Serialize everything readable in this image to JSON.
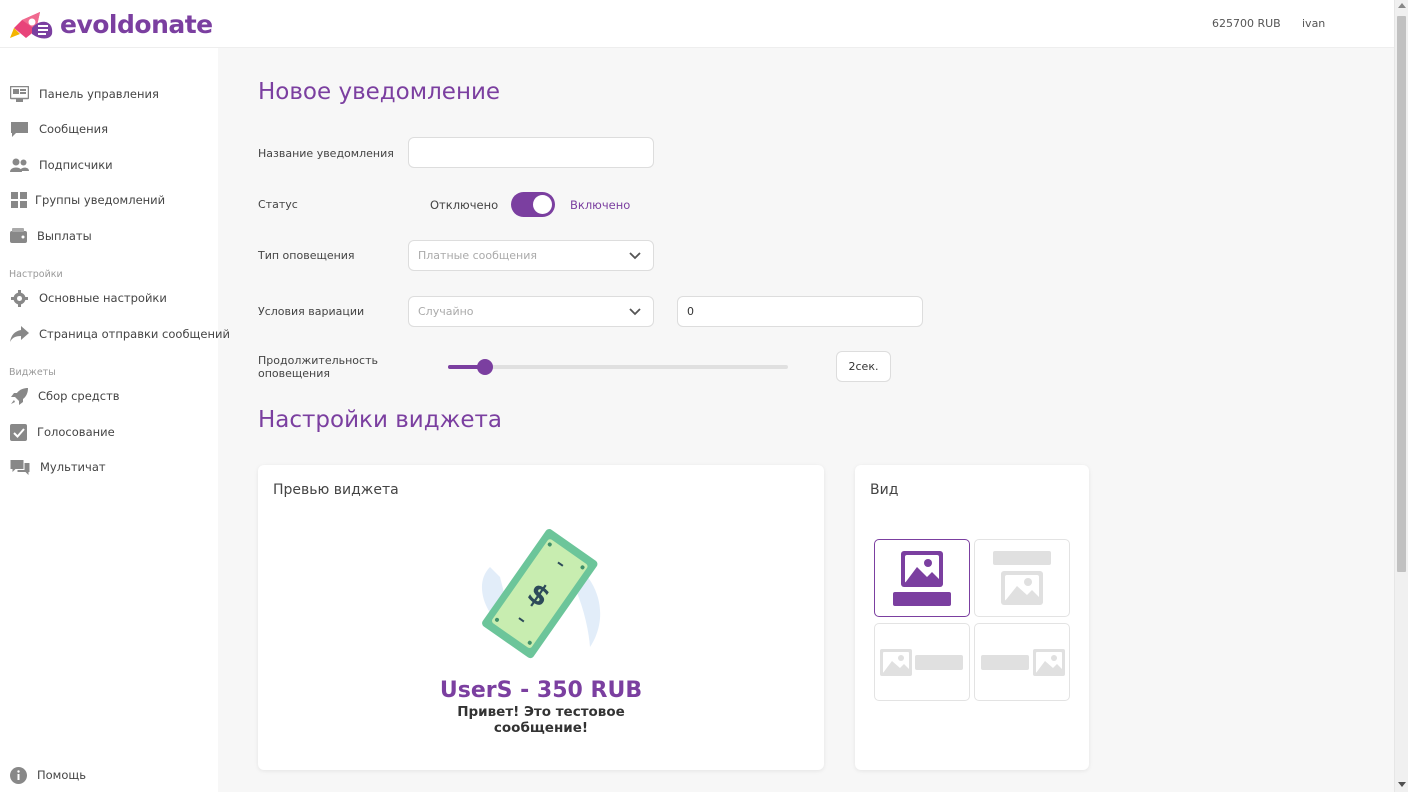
{
  "header": {
    "logo_text": "evoldonate",
    "balance": "625700 RUB",
    "username": "ivan"
  },
  "sidebar": {
    "items": [
      {
        "label": "Панель управления",
        "icon": "dashboard-icon"
      },
      {
        "label": "Сообщения",
        "icon": "message-icon"
      },
      {
        "label": "Подписчики",
        "icon": "users-icon"
      },
      {
        "label": "Группы уведомлений",
        "icon": "grid-icon"
      },
      {
        "label": "Выплаты",
        "icon": "wallet-icon"
      }
    ],
    "settings_section": "Настройки",
    "settings_items": [
      {
        "label": "Основные настройки",
        "icon": "gear-icon"
      },
      {
        "label": "Страница отправки сообщений",
        "icon": "share-icon"
      }
    ],
    "widgets_section": "Виджеты",
    "widget_items": [
      {
        "label": "Сбор средств",
        "icon": "rocket-icon"
      },
      {
        "label": "Голосование",
        "icon": "checkbox-icon"
      },
      {
        "label": "Мультичат",
        "icon": "chat-icon"
      }
    ],
    "help": {
      "label": "Помощь",
      "icon": "info-icon"
    }
  },
  "form": {
    "heading": "Новое уведомление",
    "name_label": "Название уведомления",
    "name_value": "",
    "status_label": "Статус",
    "status_off": "Отключено",
    "status_on": "Включено",
    "status_enabled": true,
    "type_label": "Тип оповещения",
    "type_value": "Платные сообщения",
    "variation_label": "Условия вариации",
    "variation_value": "Случайно",
    "variation_number": "0",
    "duration_label": "Продолжительность оповещения",
    "duration_value": "2сек.",
    "duration_level": 0.11
  },
  "widget": {
    "heading": "Настройки виджета",
    "preview_title": "Превью виджета",
    "preview_name": "UserS - 350 RUB",
    "preview_message": "Привет! Это тестовое сообщение!",
    "view_title": "Вид",
    "selected_view": 0
  },
  "colors": {
    "accent": "#7b3fa0",
    "background": "#f7f7f7"
  }
}
